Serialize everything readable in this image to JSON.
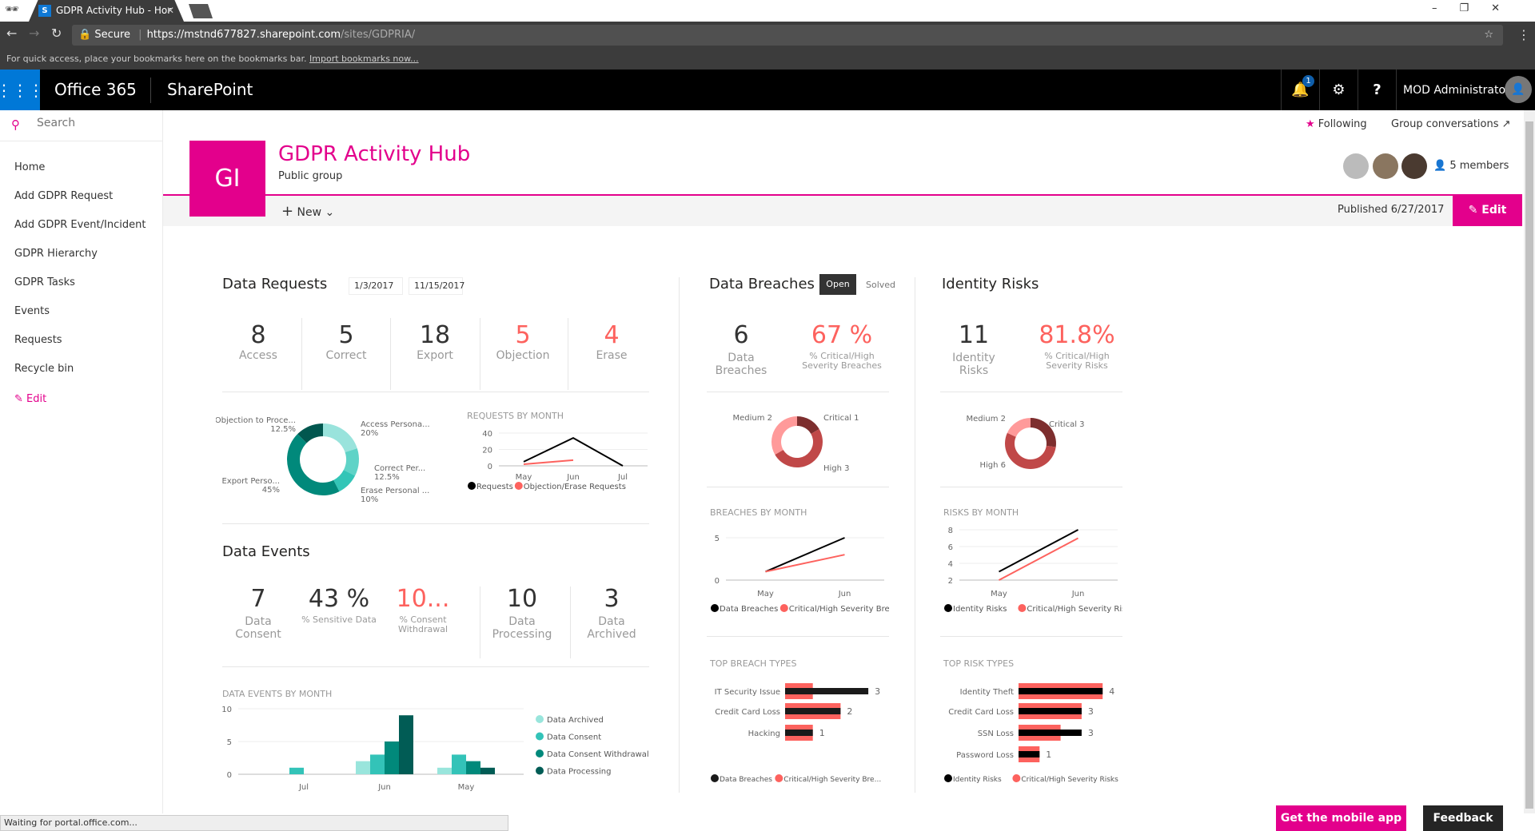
{
  "browser": {
    "tab_title": "GDPR Activity Hub - Hor",
    "secure_label": "Secure",
    "url_host": "https://mstnd677827.sharepoint.com",
    "url_path": "/sites/GDPRIA/",
    "bookmarks_text": "For quick access, place your bookmarks here on the bookmarks bar.",
    "bookmarks_link": "Import bookmarks now...",
    "status": "Waiting for portal.office.com..."
  },
  "suite": {
    "app": "Office 365",
    "product": "SharePoint",
    "notification_count": "1",
    "user": "MOD Administrator"
  },
  "search": {
    "placeholder": "Search"
  },
  "nav": {
    "items": [
      "Home",
      "Add GDPR Request",
      "Add GDPR Event/Incident",
      "GDPR Hierarchy",
      "GDPR Tasks",
      "Events",
      "Requests",
      "Recycle bin"
    ],
    "edit": "Edit"
  },
  "site": {
    "logo": "GI",
    "title": "GDPR Activity Hub",
    "subtitle": "Public group",
    "following": "Following",
    "conversations": "Group conversations",
    "members": "5 members",
    "new": "New",
    "published": "Published 6/27/2017",
    "edit": "Edit",
    "accent": "#e3008c"
  },
  "requests": {
    "title": "Data Requests",
    "date_from": "1/3/2017",
    "date_to": "11/15/2017",
    "kpis": [
      {
        "value": "8",
        "label": "Access"
      },
      {
        "value": "5",
        "label": "Correct"
      },
      {
        "value": "18",
        "label": "Export"
      },
      {
        "value": "5",
        "label": "Objection",
        "alert": true
      },
      {
        "value": "4",
        "label": "Erase",
        "alert": true
      }
    ]
  },
  "events": {
    "title": "Data Events",
    "kpis": [
      {
        "value": "7",
        "label": "Data Consent"
      },
      {
        "value": "43 %",
        "label": "% Sensitive Data"
      },
      {
        "value": "10...",
        "label": "% Consent Withdrawal",
        "alert": true
      },
      {
        "value": "10",
        "label": "Data Processing"
      },
      {
        "value": "3",
        "label": "Data Archived"
      }
    ]
  },
  "breaches": {
    "title": "Data Breaches",
    "toggle": [
      "Open",
      "Solved"
    ],
    "selected": "Open",
    "kpis": [
      {
        "value": "6",
        "label": "Data Breaches"
      },
      {
        "value": "67 %",
        "label": "% Critical/High Severity Breaches",
        "alert": true
      }
    ]
  },
  "risks": {
    "title": "Identity Risks",
    "kpis": [
      {
        "value": "11",
        "label": "Identity Risks"
      },
      {
        "value": "81.8%",
        "label": "% Critical/High Severity Risks",
        "alert": true
      }
    ]
  },
  "footer": {
    "mobile": "Get the mobile app",
    "feedback": "Feedback"
  },
  "chart_data": [
    {
      "id": "req-donut",
      "type": "pie",
      "categories": [
        "Access Persona...",
        "Correct Per...",
        "Erase Personal ...",
        "Export Perso...",
        "Objection to Proce..."
      ],
      "values": [
        20,
        12.5,
        10,
        45,
        12.5
      ],
      "value_labels": [
        "20%",
        "12.5%",
        "10%",
        "45%",
        "12.5%"
      ],
      "colors": [
        "#99e3dc",
        "#5fd3c7",
        "#33c5b7",
        "#01897b",
        "#01574f"
      ]
    },
    {
      "id": "req-line",
      "type": "line",
      "title": "REQUESTS BY MONTH",
      "categories": [
        "May",
        "Jun",
        "Jul"
      ],
      "yticks": [
        0,
        20,
        40
      ],
      "ylim": [
        0,
        40
      ],
      "series": [
        {
          "name": "Requests",
          "values": [
            5,
            34,
            0
          ],
          "color": "#000000"
        },
        {
          "name": "Objection/Erase Requests",
          "values": [
            2,
            7,
            null
          ],
          "color": "#fd625e"
        }
      ]
    },
    {
      "id": "events-bar",
      "type": "bar",
      "title": "DATA EVENTS BY MONTH",
      "categories": [
        "Jul",
        "Jun",
        "May"
      ],
      "yticks": [
        0,
        5,
        10
      ],
      "ylim": [
        0,
        10
      ],
      "legend": "right",
      "series": [
        {
          "name": "Data Archived",
          "values": [
            0,
            2,
            1
          ],
          "color": "#99e5dc"
        },
        {
          "name": "Data Consent",
          "values": [
            1,
            3,
            3
          ],
          "color": "#33c3b8"
        },
        {
          "name": "Data Consent Withdrawal",
          "values": [
            0,
            5,
            2
          ],
          "color": "#01897b"
        },
        {
          "name": "Data Processing",
          "values": [
            0,
            9,
            1
          ],
          "color": "#015c55"
        }
      ]
    },
    {
      "id": "breach-donut",
      "type": "pie",
      "categories": [
        "Critical",
        "High",
        "Medium"
      ],
      "values": [
        1,
        3,
        2
      ],
      "colors": [
        "#7d2e2e",
        "#c04848",
        "#ff9a9a"
      ]
    },
    {
      "id": "breach-line",
      "type": "line",
      "title": "BREACHES BY MONTH",
      "categories": [
        "May",
        "Jun"
      ],
      "yticks": [
        0,
        5
      ],
      "ylim": [
        0,
        5
      ],
      "series": [
        {
          "name": "Data Breaches",
          "values": [
            1,
            5
          ],
          "color": "#000000"
        },
        {
          "name": "Critical/High Severity Bre...",
          "values": [
            1,
            3
          ],
          "color": "#fd625e"
        }
      ]
    },
    {
      "id": "breach-types",
      "type": "bar",
      "orientation": "horizontal",
      "title": "TOP BREACH TYPES",
      "categories": [
        "IT Security Issue",
        "Credit Card Loss",
        "Hacking"
      ],
      "series": [
        {
          "name": "Data Breaches",
          "values": [
            3,
            2,
            1
          ],
          "color": "#1a1a1a"
        },
        {
          "name": "Critical/High Severity Bre...",
          "values": [
            1,
            2,
            1
          ],
          "color": "#fd625e"
        }
      ]
    },
    {
      "id": "risk-donut",
      "type": "pie",
      "categories": [
        "Critical",
        "High",
        "Medium"
      ],
      "values": [
        3,
        6,
        2
      ],
      "colors": [
        "#7d2e2e",
        "#c04848",
        "#ff9a9a"
      ]
    },
    {
      "id": "risk-line",
      "type": "line",
      "title": "RISKS BY MONTH",
      "categories": [
        "May",
        "Jun"
      ],
      "yticks": [
        2,
        4,
        6,
        8
      ],
      "ylim": [
        2,
        8
      ],
      "series": [
        {
          "name": "Identity Risks",
          "values": [
            3,
            8
          ],
          "color": "#000000"
        },
        {
          "name": "Critical/High Severity Risks",
          "values": [
            2,
            7
          ],
          "color": "#fd625e"
        }
      ]
    },
    {
      "id": "risk-types",
      "type": "bar",
      "orientation": "horizontal",
      "title": "TOP RISK TYPES",
      "categories": [
        "Identity Theft",
        "Credit Card Loss",
        "SSN Loss",
        "Password Loss"
      ],
      "series": [
        {
          "name": "Identity Risks",
          "values": [
            4,
            3,
            3,
            1
          ],
          "color": "#000000"
        },
        {
          "name": "Critical/High Severity Risks",
          "values": [
            4,
            3,
            2,
            1
          ],
          "color": "#fd625e"
        }
      ]
    }
  ]
}
